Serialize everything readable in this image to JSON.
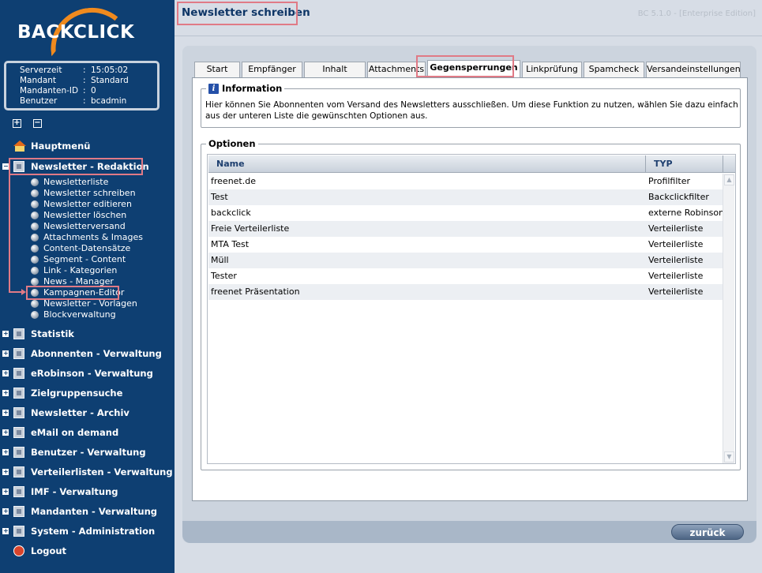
{
  "logo": {
    "text": "BACKCLICK"
  },
  "info": {
    "rows": [
      {
        "key": "Serverzeit",
        "value": "15:05:02"
      },
      {
        "key": "Mandant",
        "value": "Standard"
      },
      {
        "key": "Mandanten-ID",
        "value": "0"
      },
      {
        "key": "Benutzer",
        "value": "bcadmin"
      }
    ]
  },
  "tree": {
    "expand_all": "+",
    "collapse_all": "−"
  },
  "nav": {
    "main_menu": "Hauptmenü",
    "redaktion": "Newsletter - Redaktion",
    "sub": [
      "Newsletterliste",
      "Newsletter schreiben",
      "Newsletter editieren",
      "Newsletter löschen",
      "Newsletterversand",
      "Attachments & Images",
      "Content-Datensätze",
      "Segment - Content",
      "Link - Kategorien",
      "News - Manager",
      "Kampagnen-Editor",
      "Newsletter - Vorlagen",
      "Blockverwaltung"
    ],
    "sections": [
      "Statistik",
      "Abonnenten - Verwaltung",
      "eRobinson - Verwaltung",
      "Zielgruppensuche",
      "Newsletter - Archiv",
      "eMail on demand",
      "Benutzer - Verwaltung",
      "Verteilerlisten - Verwaltung",
      "IMF - Verwaltung",
      "Mandanten - Verwaltung",
      "System - Administration"
    ],
    "logout": "Logout"
  },
  "header": {
    "title": "Newsletter schreiben",
    "version": "BC 5.1.0 - [Enterprise Edition]"
  },
  "tabs": [
    "Start",
    "Empfänger",
    "Inhalt",
    "Attachments",
    "Gegensperrungen",
    "Linkprüfung",
    "Spamcheck",
    "Versandeinstellungen"
  ],
  "active_tab": "Gegensperrungen",
  "information": {
    "legend": "Information",
    "icon": "i",
    "text": "Hier können Sie Abonnenten vom Versand des Newsletters ausschließen. Um diese Funktion zu nutzen, wählen Sie dazu einfach aus der unteren Liste die gewünschten Optionen aus."
  },
  "options": {
    "legend": "Optionen",
    "columns": [
      "Name",
      "TYP"
    ],
    "rows": [
      [
        "freenet.de",
        "Profilfilter"
      ],
      [
        "Test",
        "Backclickfilter"
      ],
      [
        "backclick",
        "externe Robinsonliste"
      ],
      [
        "Freie Verteilerliste",
        "Verteilerliste"
      ],
      [
        "MTA Test",
        "Verteilerliste"
      ],
      [
        "Müll",
        "Verteilerliste"
      ],
      [
        "Tester",
        "Verteilerliste"
      ],
      [
        "freenet Präsentation",
        "Verteilerliste"
      ]
    ]
  },
  "footer": {
    "back_label": "zurück"
  },
  "colors": {
    "sidebar": "#0e3f72",
    "accent": "#f08a1e",
    "highlight_box": "#e07a86"
  }
}
